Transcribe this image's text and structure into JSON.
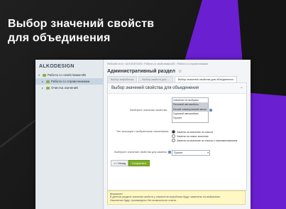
{
  "headline": "Выбор значений свойств\nдля объединения",
  "colors": {
    "accent_purple": "#6a1fd0",
    "save_green": "#7fae26",
    "notice_yellow": "#fff8c4"
  },
  "window": {
    "logo": "ALKODESIGN",
    "sidebar": {
      "items": [
        {
          "label": "Работа со свойствами-ИБ",
          "icon": "folder-icon",
          "level": 0,
          "active": false
        },
        {
          "label": "Работа со справочниками",
          "icon": "folder-icon",
          "level": 1,
          "active": true
        },
        {
          "label": "Очистка значений",
          "icon": "folder-icon",
          "level": 1,
          "active": false
        }
      ]
    },
    "breadcrumbs": "Рабочий стол  ›  ALKODESIGN  ›  Работа со свойствами-ИБ  ›  Работа со справочниками",
    "page_title": "Административный раздел",
    "tabs": [
      {
        "label": "Выбор инфоблока",
        "active": false
      },
      {
        "label": "Выбор свойств для ...",
        "active": false
      },
      {
        "label": "Выбор значений свойства для объединения",
        "active": true
      }
    ],
    "panel": {
      "title": "Выбор значений свойства для объединения",
      "values_label": "Выберите значения свойства:",
      "options": [
        {
          "text": "значение не выбрано",
          "selected": false
        },
        {
          "text": "Легковой автомобиль",
          "selected": true
        },
        {
          "text": "Легкий коммерческий автом",
          "selected": true
        },
        {
          "text": "Грузовой автомобиль",
          "selected": false
        },
        {
          "text": "Прочее",
          "selected": false
        }
      ],
      "operation_label": "Тип операции с выбранными значениями:",
      "radios": [
        {
          "text": "Замена на значение из списка",
          "checked": true
        },
        {
          "text": "Замена на новое значение",
          "checked": false
        },
        {
          "text": "Замена на значение из списка с переименованием",
          "checked": false
        }
      ],
      "replace_label": "Выберите значение свойства для замены:",
      "replace_value": "Прочее",
      "back_button": "<< Назад",
      "save_button": "Сохранить"
    },
    "notice": {
      "title": "Внимание!",
      "line1": "В данном разделе значения свойств у элементов инфоблока будут заменены на выбранные.",
      "line2": "Изменения будут произведены без возможности отката."
    }
  }
}
